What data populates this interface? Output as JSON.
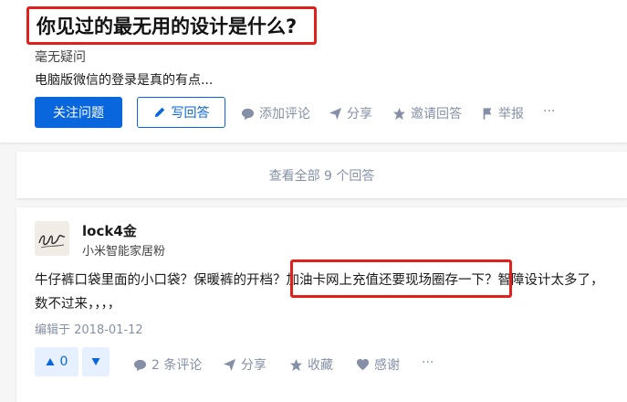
{
  "question": {
    "title": "你见过的最无用的设计是什么?",
    "tag": "毫无疑问",
    "description": "电脑版微信的登录是真的有点...",
    "follow_label": "关注问题",
    "write_label": "写回答",
    "actions": {
      "comment": "添加评论",
      "share": "分享",
      "invite": "邀请回答",
      "report": "举报",
      "more": "···"
    }
  },
  "view_all": "查看全部 9 个回答",
  "answer": {
    "author_name": "lock4金",
    "author_bio": "小米智能家居粉",
    "text_line1_a": "牛仔裤口袋里面的小口袋？保暖裤的开档？",
    "text_line1_b": "加油卡网上充值还要现场圈存一下？",
    "text_line1_c": "智障设计太多了，",
    "text_line2": "数不过来，，，，",
    "edit_date": "编辑于 2018-01-12",
    "votes": "0",
    "actions": {
      "comments": "2 条评论",
      "share": "分享",
      "collect": "收藏",
      "thanks": "感谢",
      "more": "···"
    }
  },
  "colors": {
    "brand_blue": "#0a66dc",
    "highlight_red": "#e0201b",
    "muted": "#8590a6"
  },
  "icons": [
    "pen-icon",
    "comment-icon",
    "share-icon",
    "star-icon",
    "flag-icon",
    "more-icon",
    "upvote-icon",
    "downvote-icon",
    "heart-icon"
  ]
}
